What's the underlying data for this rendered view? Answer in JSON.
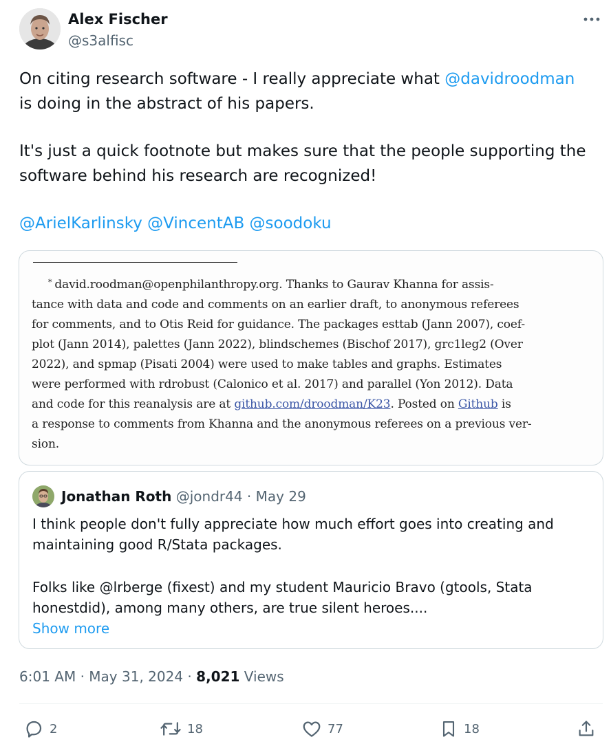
{
  "author": {
    "name": "Alex Fischer",
    "handle": "@s3alfisc"
  },
  "post": {
    "p1_before": "On citing research software - I really appreciate what ",
    "p1_mention": "@davidroodman",
    "p1_after": " is doing in the abstract of his papers.",
    "p2": "It's just a quick footnote but makes sure that the people supporting the software behind his research are recognized!",
    "mentions": [
      "@ArielKarlinsky",
      "@VincentAB",
      "@soodoku"
    ]
  },
  "footnote": {
    "marker": "*",
    "line1": "david.roodman@openphilanthropy.org. Thanks to Gaurav Khanna for assis-",
    "line2": "tance with data and code and comments on an earlier draft, to anonymous referees",
    "line3": "for comments, and to Otis Reid for guidance. The packages esttab (Jann 2007), coef-",
    "line4": "plot (Jann 2014), palettes (Jann 2022), blindschemes (Bischof 2017), grc1leg2 (Over",
    "line5": "2022), and spmap (Pisati 2004) were used to make tables and graphs. Estimates",
    "line6": "were performed with rdrobust (Calonico et al. 2017) and parallel (Yon 2012). Data",
    "line7_before": "and code for this reanalysis are at ",
    "line7_link1": "github.com/droodman/K23",
    "line7_mid": ". Posted on ",
    "line7_link2": "Github",
    "line7_after": " is",
    "line8": "a response to comments from Khanna and the anonymous referees on a previous ver-",
    "line9": "sion."
  },
  "quote": {
    "name": "Jonathan Roth",
    "handle": "@jondr44",
    "separator": " · ",
    "date": "May 29",
    "p1": "I think people don't fully appreciate how much effort goes into creating and maintaining good R/Stata packages.",
    "p2": "Folks like @lrberge (fixest) and my student Mauricio Bravo (gtools, Stata honestdid), among many others, are true silent heroes....",
    "show_more": "Show more"
  },
  "meta": {
    "time": "6:01 AM",
    "sep1": " · ",
    "date": "May 31, 2024",
    "sep2": " · ",
    "views_count": "8,021",
    "views_label": " Views"
  },
  "actions": {
    "replies": "2",
    "reposts": "18",
    "likes": "77",
    "bookmarks": "18"
  },
  "icons": [
    "more-icon",
    "reply-icon",
    "repost-icon",
    "like-icon",
    "bookmark-icon",
    "share-icon"
  ],
  "colors": {
    "link": "#1d9bf0",
    "text": "#0f1419",
    "muted": "#536471",
    "border": "#cfd9de"
  }
}
